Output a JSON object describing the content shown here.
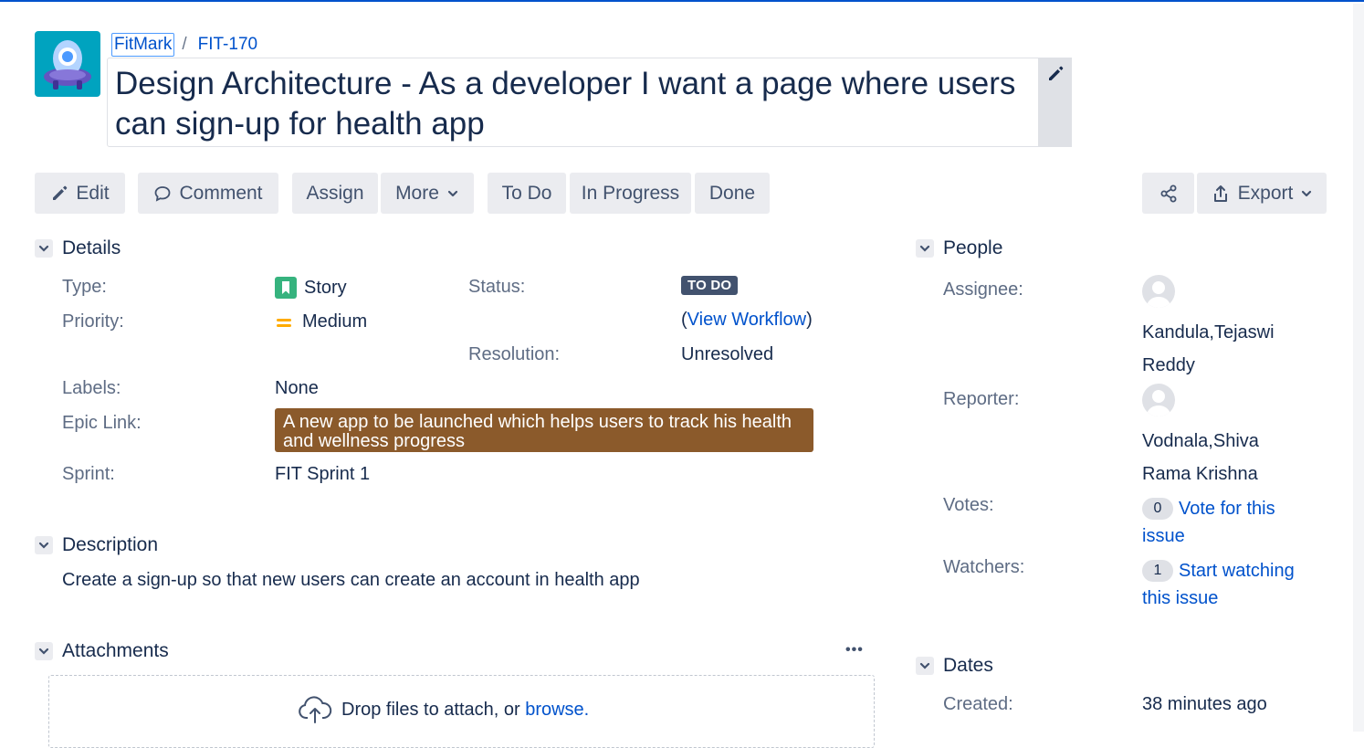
{
  "breadcrumb": {
    "project": "FitMark",
    "separator": "/",
    "issue_key": "FIT-170"
  },
  "summary": "Design Architecture - As a developer I want a page where users can sign-up for health app",
  "toolbar": {
    "edit": "Edit",
    "comment": "Comment",
    "assign": "Assign",
    "more": "More",
    "todo": "To Do",
    "in_progress": "In Progress",
    "done": "Done",
    "export": "Export"
  },
  "details": {
    "heading": "Details",
    "type_label": "Type:",
    "type_value": "Story",
    "priority_label": "Priority:",
    "priority_value": "Medium",
    "status_label": "Status:",
    "status_value": "TO DO",
    "workflow_open": "(",
    "workflow_link": "View Workflow",
    "workflow_close": ")",
    "resolution_label": "Resolution:",
    "resolution_value": "Unresolved",
    "labels_label": "Labels:",
    "labels_value": "None",
    "epic_label": "Epic Link:",
    "epic_value": "A new app to be launched which helps users to track his health and wellness progress",
    "sprint_label": "Sprint:",
    "sprint_value": "FIT Sprint 1"
  },
  "description": {
    "heading": "Description",
    "text": "Create a sign-up so that new users can create an account in health app"
  },
  "attachments": {
    "heading": "Attachments",
    "more": "•••",
    "drop_text": "Drop files to attach, or ",
    "browse": "browse."
  },
  "people": {
    "heading": "People",
    "assignee_label": "Assignee:",
    "assignee_line1": "Kandula,Tejaswi",
    "assignee_line2": "Reddy",
    "reporter_label": "Reporter:",
    "reporter_line1": "Vodnala,Shiva",
    "reporter_line2": "Rama Krishna",
    "votes_label": "Votes:",
    "votes_count": "0",
    "votes_link_1": "Vote for this",
    "votes_link_2": "issue",
    "watchers_label": "Watchers:",
    "watchers_count": "1",
    "watchers_link_1": "Start watching",
    "watchers_link_2": "this issue"
  },
  "dates": {
    "heading": "Dates",
    "created_label": "Created:",
    "created_value": "38 minutes ago"
  },
  "colors": {
    "accent": "#0052cc",
    "epic": "#8b5a2b",
    "story": "#36b37e",
    "priority_medium": "#ffab00",
    "status_todo": "#42526e"
  },
  "icons": [
    "pencil-icon",
    "comment-icon",
    "chevron-down-icon",
    "share-icon",
    "export-icon",
    "story-icon",
    "priority-medium-icon",
    "user-avatar-icon",
    "cloud-upload-icon"
  ]
}
